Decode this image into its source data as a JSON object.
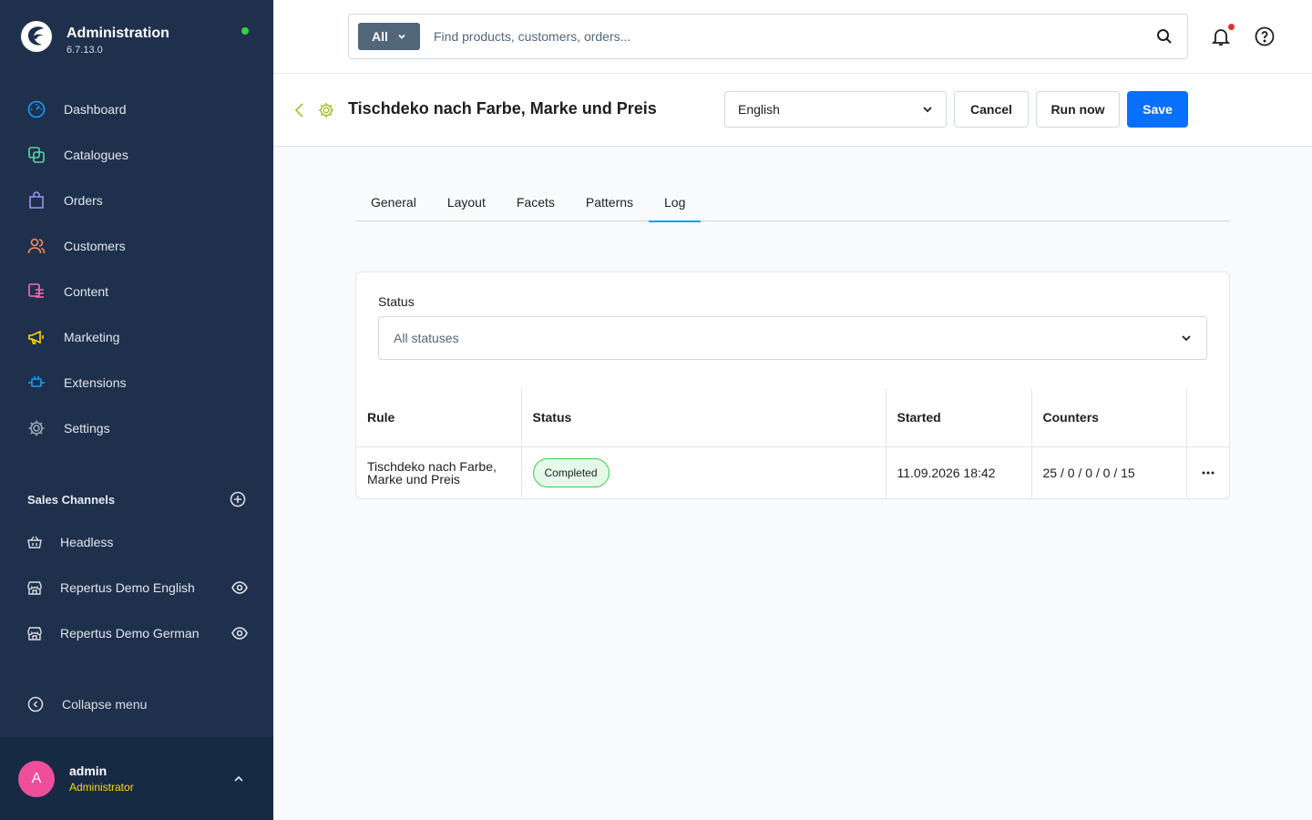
{
  "app": {
    "title": "Administration",
    "version": "6.7.13.0"
  },
  "nav": {
    "items": [
      {
        "label": "Dashboard"
      },
      {
        "label": "Catalogues"
      },
      {
        "label": "Orders"
      },
      {
        "label": "Customers"
      },
      {
        "label": "Content"
      },
      {
        "label": "Marketing"
      },
      {
        "label": "Extensions"
      },
      {
        "label": "Settings"
      }
    ]
  },
  "sales_channels": {
    "title": "Sales Channels",
    "items": [
      {
        "label": "Headless"
      },
      {
        "label": "Repertus Demo English"
      },
      {
        "label": "Repertus Demo German"
      }
    ]
  },
  "collapse_label": "Collapse menu",
  "user": {
    "initial": "A",
    "name": "admin",
    "role": "Administrator"
  },
  "search": {
    "type_label": "All",
    "placeholder": "Find products, customers, orders..."
  },
  "smartbar": {
    "title": "Tischdeko nach Farbe, Marke und Preis",
    "language": "English",
    "cancel": "Cancel",
    "run_now": "Run now",
    "save": "Save"
  },
  "tabs": [
    {
      "label": "General"
    },
    {
      "label": "Layout"
    },
    {
      "label": "Facets"
    },
    {
      "label": "Patterns"
    },
    {
      "label": "Log",
      "active": true
    }
  ],
  "filter": {
    "label": "Status",
    "value": "All statuses"
  },
  "table": {
    "headers": [
      "Rule",
      "Status",
      "Started",
      "Counters"
    ],
    "rows": [
      {
        "rule": "Tischdeko nach Farbe, Marke und Preis",
        "status": "Completed",
        "started": "11.09.2026 18:42",
        "counters": "25 / 0 / 0 / 0 / 15"
      }
    ]
  },
  "colors": {
    "sidebar_bg": "#1e304c",
    "primary": "#0870ff",
    "success": "#37d046",
    "tab_active": "#189eff",
    "role_yellow": "#ffd700"
  }
}
